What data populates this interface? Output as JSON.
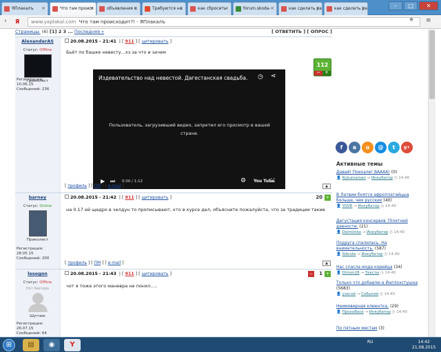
{
  "tabs": [
    {
      "label": "ЯПлакалъ",
      "active": false
    },
    {
      "label": "Что там происх",
      "active": true
    },
    {
      "label": "объявления о",
      "active": false
    },
    {
      "label": "Требуются на",
      "active": false
    },
    {
      "label": "как сбросить",
      "active": false
    },
    {
      "label": "forum.skoda-",
      "active": false
    },
    {
      "label": "как сделать ра",
      "active": false
    },
    {
      "label": "как сделать ра",
      "active": false
    }
  ],
  "address": {
    "url": "www.yaplakal.com",
    "title": "Что там происходит?! - ЯПлакалъ"
  },
  "pagination": {
    "label": "Страницы:",
    "count": "(6)",
    "pages": "[1] 2 3 ...",
    "last": "Последняя »",
    "reply": "[ ОТВЕТИТЬ ]",
    "poll": "[ ОПРОС ]"
  },
  "posts": [
    {
      "user": "AlexanderAS",
      "status_label": "Статус:",
      "status": "Offline",
      "rank": "Приколист",
      "reg_label": "Регистрация:",
      "reg": "10.06.15",
      "msgs_label": "Сообщений:",
      "msgs": "236",
      "date": "20.08.2015 - 21:41",
      "num": "911",
      "quote": "цитировать",
      "text": "Бьёт по башке невесту...хз за что и зачем",
      "rating": "112",
      "video": {
        "title": "Издевательство над невестой. Дагестанская свадьба.",
        "message": "Пользователь, загрузивший видео, запретил его просмотр в вашей стране.",
        "time": "0:00 / 1:12",
        "yt": "You Tube"
      }
    },
    {
      "user": "barney",
      "status_label": "Статус:",
      "status": "Online",
      "rank": "Приколист",
      "reg_label": "Регистрация:",
      "reg": "28.05.15",
      "msgs_label": "Сообщений:",
      "msgs": "200",
      "date": "20.08.2015 - 21:42",
      "num": "911",
      "quote": "цитировать",
      "text": "на 0.17 ей щедро в челдун то прописывают, кто в курсе дел, объясните пожалуйста, что за традиции такие",
      "rating": "20"
    },
    {
      "user": "lesogon",
      "status_label": "Статус:",
      "status": "Offline",
      "avatar_text": "Нет Аватара",
      "rank": "Шутник",
      "reg_label": "Регистрация:",
      "reg": "26.07.15",
      "msgs_label": "Сообщений:",
      "msgs": "64",
      "date": "20.08.2015 - 21:43",
      "num": "911",
      "quote": "цитировать",
      "text": "чот я тоже этого маневра не понял.....",
      "rating": "1"
    }
  ],
  "footer_links": {
    "profile": "профиль",
    "pm": "ПМ",
    "email": "e-mail"
  },
  "sidebar": {
    "social": [
      "f",
      "в",
      "о",
      "@",
      "t",
      "g+"
    ],
    "active_title": "Активные темы",
    "topics": [
      {
        "title": "Давай! Поехали! ВАААА!",
        "count": "(0)",
        "user": "Kukumaman",
        "section": "Инкубатор",
        "time": "14:40"
      },
      {
        "title": "В Латвии боятся афроплатайцыа больше, чем русских",
        "count": "(40)",
        "user": "YOVR",
        "section": "Инкубатор",
        "time": "14:40"
      },
      {
        "title": "Дегустация консервов 70летней давности.",
        "count": "(21)",
        "user": "Deimiinko",
        "section": "Инкубатор",
        "time": "14:40"
      },
      {
        "title": "Подруга спалилась. На внимательность.",
        "count": "(587)",
        "user": "Sibrute",
        "section": "Инкубатор",
        "time": "14:40"
      },
      {
        "title": "Нас спасла мода корейца",
        "count": "(34)",
        "user": "Dimon28",
        "section": "Тексты",
        "time": "14:40"
      },
      {
        "title": "Только что добавлю в Йаплохстушна",
        "count": "(5683)",
        "user": "узогой",
        "section": "События",
        "time": "14:40"
      },
      {
        "title": "Неимоверная клиентка.",
        "count": "(29)",
        "user": "ПрохоВасе",
        "section": "Инкубатор",
        "time": "14:40"
      },
      {
        "title": "По пятным местам",
        "count": "(3)",
        "user": "",
        "section": "",
        "time": ""
      }
    ]
  },
  "taskbar": {
    "lang": "RU",
    "time": "14:42",
    "date": "21.08.2015"
  }
}
